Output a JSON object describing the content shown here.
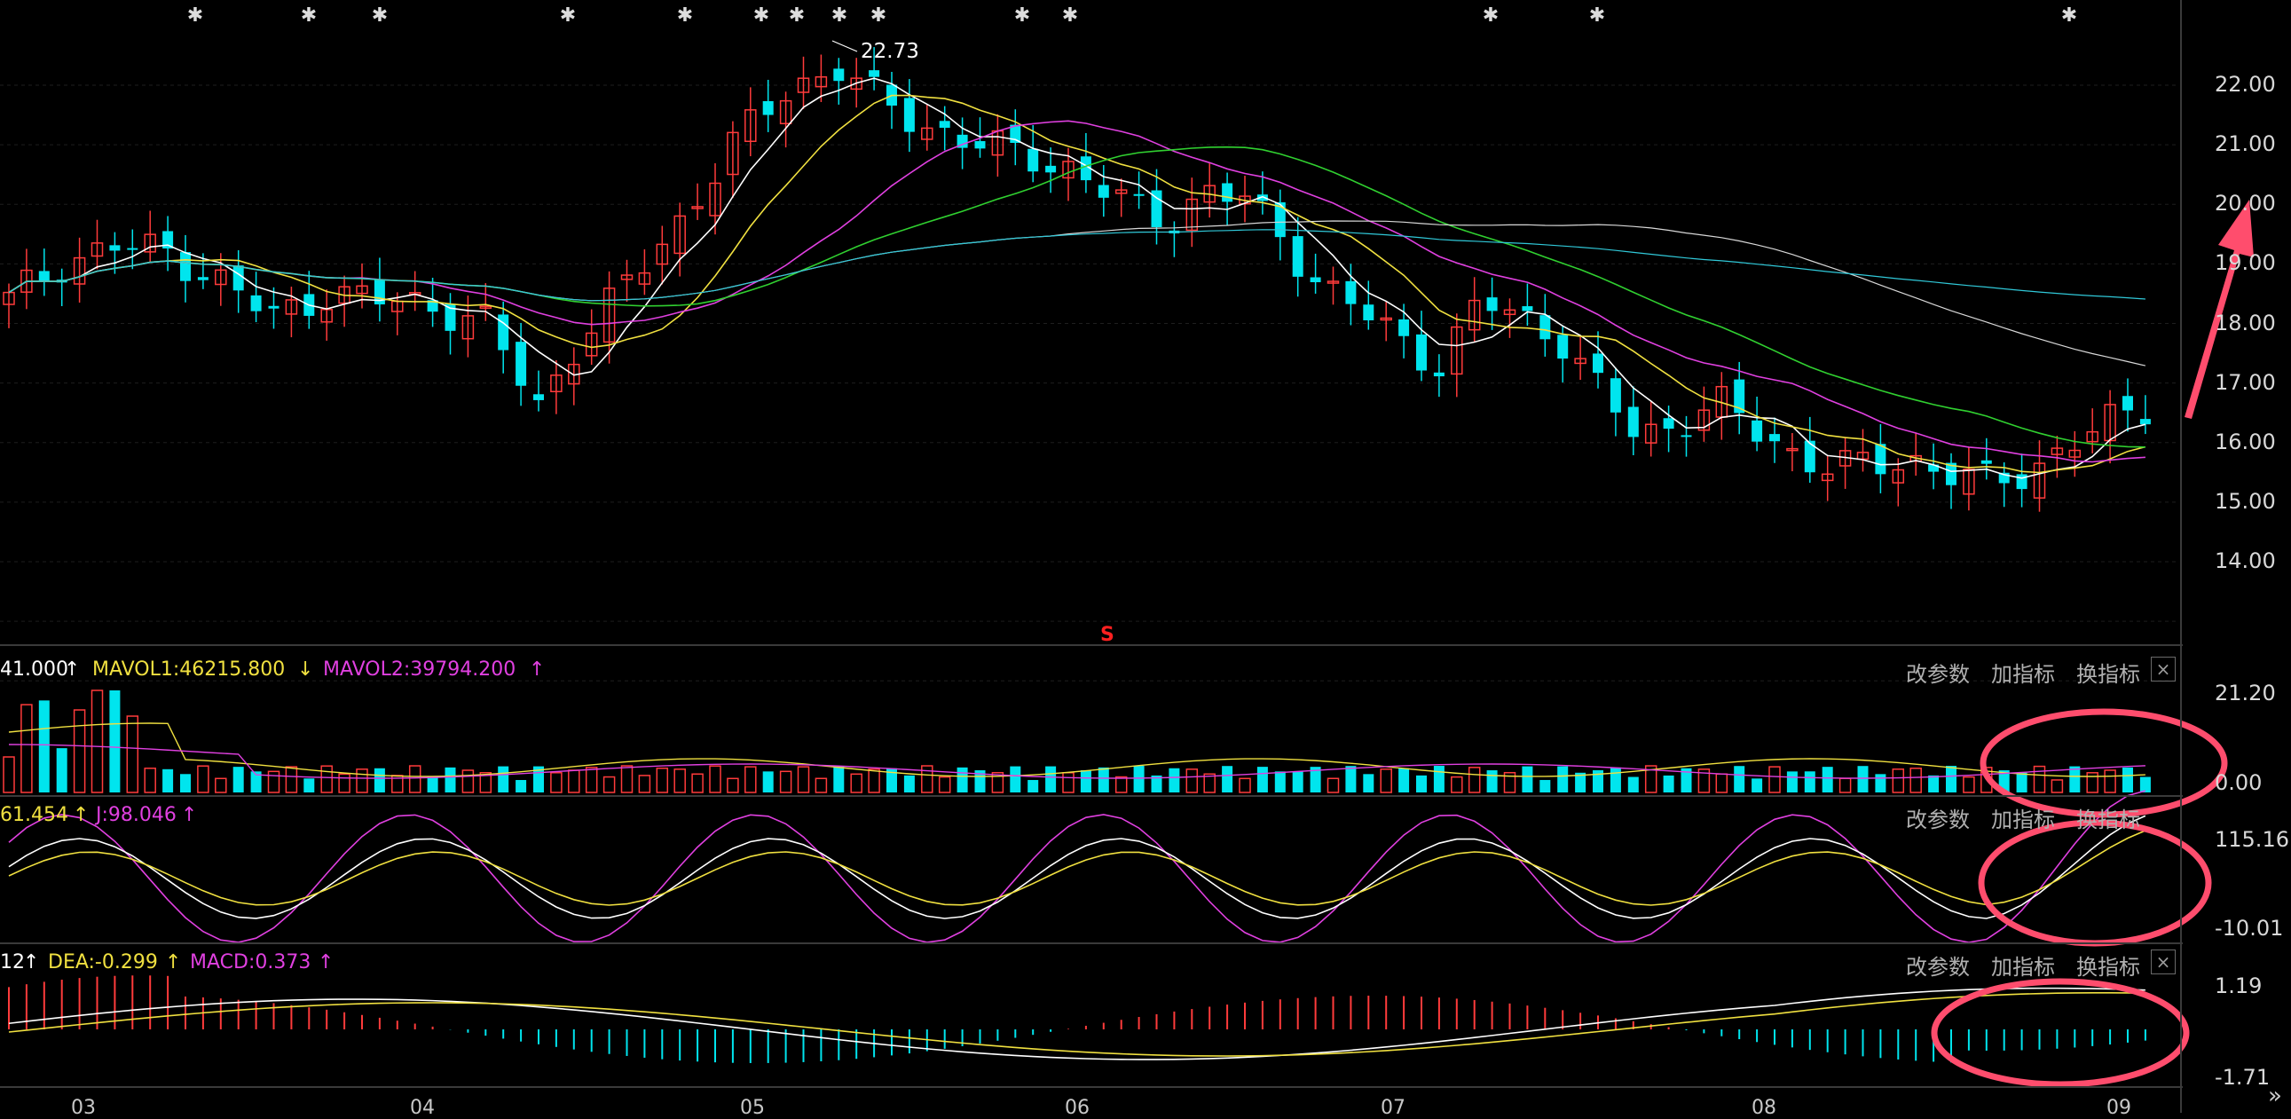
{
  "price_labels": [
    "22.00",
    "21.00",
    "20.00",
    "19.00",
    "18.00",
    "17.00",
    "16.00",
    "15.00",
    "14.00"
  ],
  "high_marker": "22.73",
  "volume_panel": {
    "stat_vol": "41.000",
    "stat_mavol1": "MAVOL1:46215.800",
    "stat_mavol2": "MAVOL2:39794.200",
    "axis_top": "21.20",
    "axis_bottom": "0.00"
  },
  "kdj_panel": {
    "stat_d": "61.454",
    "stat_j": "J:98.046",
    "axis_top": "115.16",
    "axis_bottom": "-10.01"
  },
  "macd_panel": {
    "stat_diff": "12",
    "stat_dea": "DEA:-0.299",
    "stat_macd": "MACD:0.373",
    "axis_top": "1.19",
    "axis_bottom": "-1.71"
  },
  "buttons": {
    "params": "改参数",
    "add": "加指标",
    "switch": "换指标"
  },
  "close_symbol": "×",
  "month_labels": [
    "03",
    "04",
    "05",
    "06",
    "07",
    "08",
    "09"
  ],
  "signal_s": "S",
  "colors": {
    "up": "#ff3b3b",
    "down": "#00e5ee",
    "ma1": "#ffffff",
    "ma2": "#f0e040",
    "ma3": "#e040e0",
    "ma4": "#30d030",
    "highlight": "#ff4d6d"
  },
  "chart_data": {
    "type": "candlestick",
    "x": [
      "03",
      "04",
      "05",
      "06",
      "07",
      "08",
      "09"
    ],
    "high": 22.73,
    "ylim": [
      14.0,
      22.0
    ],
    "volume_ylim": [
      0.0,
      21.2
    ],
    "kdj_ylim": [
      -10.01,
      115.16
    ],
    "macd_ylim": [
      -1.71,
      1.19
    ],
    "indicators": {
      "MAVOL1": 46215.8,
      "MAVOL2": 39794.2,
      "J": 98.046,
      "DEA": -0.299,
      "MACD": 0.373
    }
  }
}
